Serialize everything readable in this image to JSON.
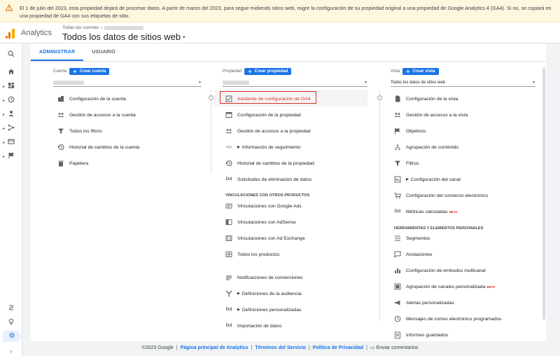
{
  "banner": {
    "text": "El 1 de julio del 2023, esta propiedad dejará de procesar datos. A partir de marzo del 2023, para seguir midiendo sitios web, migre la configuración de su propiedad original a una propiedad de Google Analytics 4 (GA4). Si no, se copiará en una propiedad de GA4 con sus etiquetas de sitio.",
    "icon": "warning-icon",
    "color": "#fef7e0"
  },
  "header": {
    "app_name": "Analytics",
    "breadcrumb_label": "Todas las cuentas",
    "property_title": "Todos los datos de sitios web"
  },
  "tabs": [
    {
      "label": "ADMINISTRAR",
      "active": true
    },
    {
      "label": "USUARIO",
      "active": false
    }
  ],
  "columns": {
    "account": {
      "label": "Cuenta",
      "create_label": "Crear cuenta",
      "selector_value": "",
      "items": [
        {
          "label": "Configuración de la cuenta",
          "icon": "building-icon"
        },
        {
          "label": "Gestión de accesos a la cuenta",
          "icon": "people-icon"
        },
        {
          "label": "Todos los filtros",
          "icon": "filter-icon"
        },
        {
          "label": "Historial de cambios de la cuenta",
          "icon": "history-icon"
        },
        {
          "label": "Papelera",
          "icon": "trash-icon"
        }
      ]
    },
    "property": {
      "label": "Propiedad",
      "create_label": "Crear propiedad",
      "selector_value": "",
      "items": [
        {
          "label": "Asistente de configuración de GA4",
          "icon": "checkbox-icon"
        },
        {
          "label": "Configuración de la propiedad",
          "icon": "settings-panel-icon"
        },
        {
          "label": "Gestión de accesos a la propiedad",
          "icon": "people-icon"
        },
        {
          "label": "Información de seguimiento",
          "icon": "code-icon"
        },
        {
          "label": "Historial de cambios de la propiedad",
          "icon": "history-icon"
        },
        {
          "label": "Solicitudes de eliminación de datos",
          "icon": "dd-icon"
        }
      ],
      "section_title": "VINCULACIONES CON OTROS PRODUCTOS",
      "links": [
        {
          "label": "Vinculaciones con Google Ads",
          "icon": "ads-icon"
        },
        {
          "label": "Vinculaciones con AdSense",
          "icon": "adsense-icon"
        },
        {
          "label": "Vinculaciones con Ad Exchange",
          "icon": "adexchange-icon"
        },
        {
          "label": "Todos los productos",
          "icon": "products-icon"
        }
      ],
      "more": [
        {
          "label": "Notificaciones de conversiones",
          "icon": "notifications-icon"
        },
        {
          "label": "Definiciones de la audiencia",
          "icon": "audience-icon"
        },
        {
          "label": "Definiciones personalizadas",
          "icon": "dd-icon"
        },
        {
          "label": "Importación de datos",
          "icon": "dd-icon"
        }
      ]
    },
    "view": {
      "label": "Vista",
      "create_label": "Crear vista",
      "selector_value": "Todos los datos de sitios web",
      "items": [
        {
          "label": "Configuración de la vista",
          "icon": "document-icon"
        },
        {
          "label": "Gestión de accesos a la vista",
          "icon": "people-icon"
        },
        {
          "label": "Objetivos",
          "icon": "flag-icon"
        },
        {
          "label": "Agrupación de contenido",
          "icon": "grouping-icon"
        },
        {
          "label": "Filtros",
          "icon": "filter-icon"
        },
        {
          "label": "Configuración del canal",
          "icon": "channel-icon"
        },
        {
          "label": "Configuración del comercio electrónico",
          "icon": "cart-icon"
        },
        {
          "label": "Métricas calculadas",
          "icon": "dd-icon",
          "badge": "BETA"
        }
      ],
      "section_title": "HERRAMIENTAS Y ELEMENTOS PERSONALES",
      "tools": [
        {
          "label": "Segmentos",
          "icon": "segments-icon"
        },
        {
          "label": "Anotaciones",
          "icon": "comment-icon"
        },
        {
          "label": "Configuración de embudos multicanal",
          "icon": "bar-chart-icon"
        },
        {
          "label": "Agrupación de canales personalizada",
          "icon": "custom-channel-icon",
          "badge": "BETA"
        },
        {
          "label": "Alertas personalizadas",
          "icon": "megaphone-icon"
        },
        {
          "label": "Mensajes de correo electrónico programados",
          "icon": "clock-mail-icon"
        },
        {
          "label": "Informes guardados",
          "icon": "saved-report-icon"
        }
      ]
    }
  },
  "footer": {
    "copyright": "©2023 Google",
    "home_link": "Página principal de Analytics",
    "terms_link": "Términos del Servicio",
    "privacy_link": "Política de Privacidad",
    "feedback": "Enviar comentarios"
  }
}
